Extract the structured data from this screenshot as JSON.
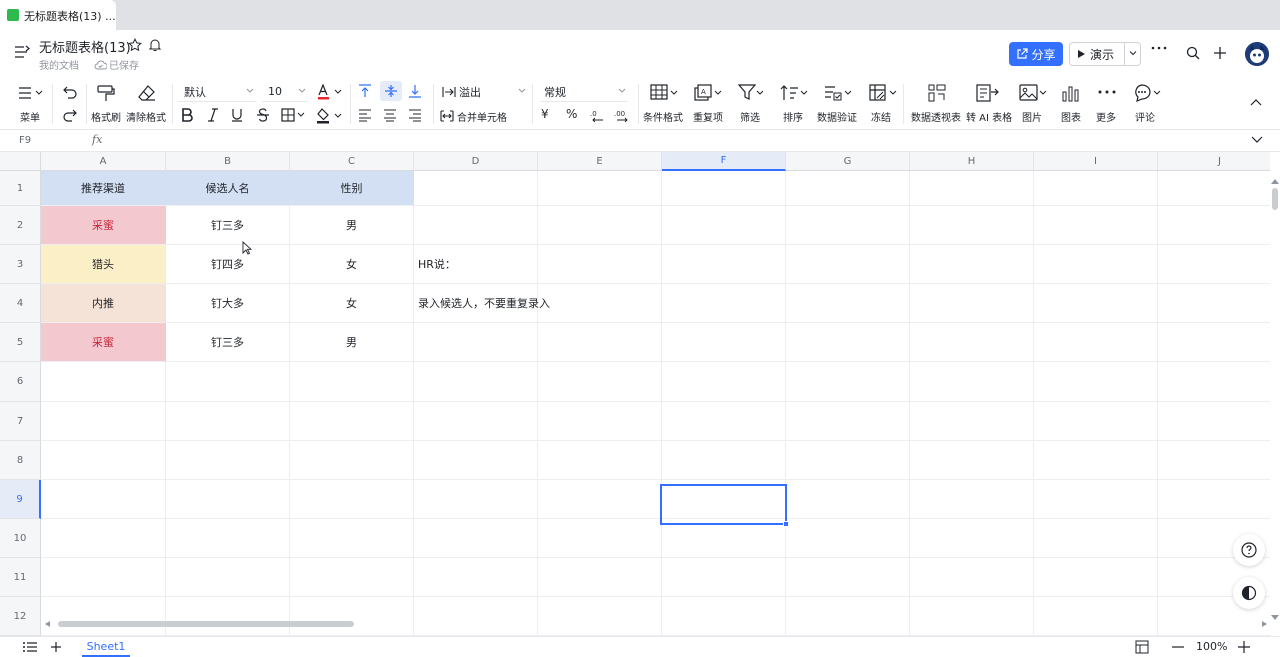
{
  "browser": {
    "tab_title": "无标题表格(13) ..."
  },
  "header": {
    "title": "无标题表格(13)",
    "location": "我的文档",
    "save_status": "已保存",
    "share_label": "分享",
    "present_label": "演示"
  },
  "toolbar": {
    "menu_label": "菜单",
    "format_painter_label": "格式刷",
    "clear_format_label": "清除格式",
    "font_family": "默认",
    "font_size": "10",
    "overflow_label": "溢出",
    "merge_label": "合并单元格",
    "number_format": "常规",
    "conditional_format_label": "条件格式",
    "duplicates_label": "重复项",
    "filter_label": "筛选",
    "sort_label": "排序",
    "data_validation_label": "数据验证",
    "freeze_label": "冻结",
    "pivot_label": "数据透视表",
    "ai_table_label": "转 AI 表格",
    "image_label": "图片",
    "chart_label": "图表",
    "more_label": "更多",
    "comment_label": "评论",
    "currency_symbol": "¥",
    "percent_symbol": "%"
  },
  "formula_bar": {
    "cell_ref": "F9",
    "fx": "fx",
    "content": ""
  },
  "sheet": {
    "columns": [
      "A",
      "B",
      "C",
      "D",
      "E",
      "F",
      "G",
      "H",
      "I",
      "J"
    ],
    "rows": [
      "1",
      "2",
      "3",
      "4",
      "5",
      "6",
      "7",
      "8",
      "9",
      "10",
      "11",
      "12"
    ],
    "selected_cell": "F9",
    "cells": {
      "A1": "推荐渠道",
      "B1": "候选人名",
      "C1": "性别",
      "A2": "采蜜",
      "B2": "钉三多",
      "C2": "男",
      "A3": "猎头",
      "B3": "钉四多",
      "C3": "女",
      "D3": "HR说：",
      "A4": "内推",
      "B4": "钉大多",
      "C4": "女",
      "D4": "录入候选人，不要重复录入",
      "A5": "采蜜",
      "B5": "钉三多",
      "C5": "男"
    },
    "fills": {
      "header": "#d3dff2",
      "caimi": "#f3c9cf",
      "caimi_text": "#c5283d",
      "liechou": "#fbefc8",
      "neitui": "#f6e3d7"
    }
  },
  "bottom": {
    "sheet_tab": "Sheet1",
    "zoom": "100%"
  },
  "colors": {
    "accent": "#3370ff"
  }
}
